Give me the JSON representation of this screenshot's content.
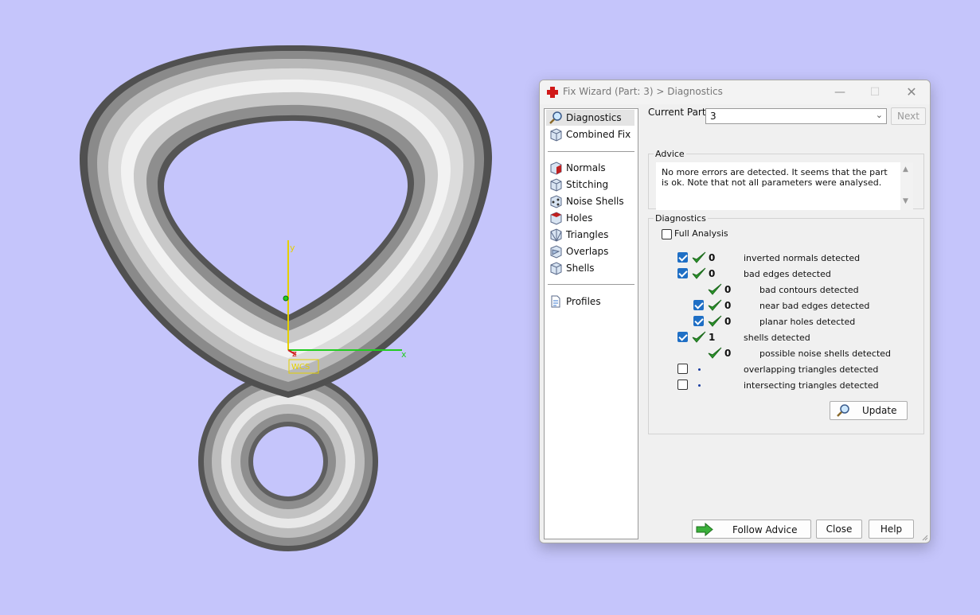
{
  "window": {
    "title": "Fix Wizard (Part: 3) > Diagnostics"
  },
  "nav": {
    "top_items": [
      {
        "label": "Diagnostics",
        "icon": "magnifier-icon"
      },
      {
        "label": "Combined Fix",
        "icon": "cube-icon"
      }
    ],
    "tool_items": [
      {
        "label": "Normals",
        "icon": "normals-cube-icon"
      },
      {
        "label": "Stitching",
        "icon": "stitching-cube-icon"
      },
      {
        "label": "Noise Shells",
        "icon": "noise-shells-icon"
      },
      {
        "label": "Holes",
        "icon": "holes-cube-icon"
      },
      {
        "label": "Triangles",
        "icon": "triangles-icon"
      },
      {
        "label": "Overlaps",
        "icon": "overlaps-icon"
      },
      {
        "label": "Shells",
        "icon": "shells-icon"
      }
    ],
    "bottom_items": [
      {
        "label": "Profiles",
        "icon": "document-icon"
      }
    ]
  },
  "current_part": {
    "label": "Current Part:",
    "value": "3",
    "next_label": "Next"
  },
  "advice": {
    "title": "Advice",
    "text": "No more errors are detected. It seems that the part is ok. Note that not all parameters were analysed."
  },
  "diagnostics": {
    "title": "Diagnostics",
    "full_analysis_label": "Full Analysis",
    "rows": [
      {
        "checked": true,
        "ok": true,
        "count": "0",
        "label": "inverted normals detected"
      },
      {
        "checked": true,
        "ok": true,
        "count": "0",
        "label": "bad edges detected"
      },
      {
        "checked": null,
        "ok": true,
        "count": "0",
        "label": "bad contours detected"
      },
      {
        "checked": true,
        "ok": true,
        "count": "0",
        "label": "near bad edges detected"
      },
      {
        "checked": true,
        "ok": true,
        "count": "0",
        "label": "planar holes detected"
      },
      {
        "checked": true,
        "ok": true,
        "count": "1",
        "label": "shells detected"
      },
      {
        "checked": null,
        "ok": true,
        "count": "0",
        "label": "possible noise shells detected"
      },
      {
        "checked": false,
        "ok": false,
        "count": "",
        "label": "overlapping triangles detected"
      },
      {
        "checked": false,
        "ok": false,
        "count": "",
        "label": "intersecting triangles detected"
      }
    ],
    "update_label": "Update"
  },
  "footer": {
    "follow_advice_label": "Follow Advice",
    "close_label": "Close",
    "help_label": "Help"
  },
  "viewport": {
    "axis_x_label": "x",
    "axis_y_label": "y",
    "axis_z_label": "z",
    "wcs_label": "WCS",
    "colors": {
      "background": "#c5c5fb",
      "x_axis": "#22cc22",
      "y_axis": "#e5d000",
      "z_axis": "#d02020"
    }
  }
}
